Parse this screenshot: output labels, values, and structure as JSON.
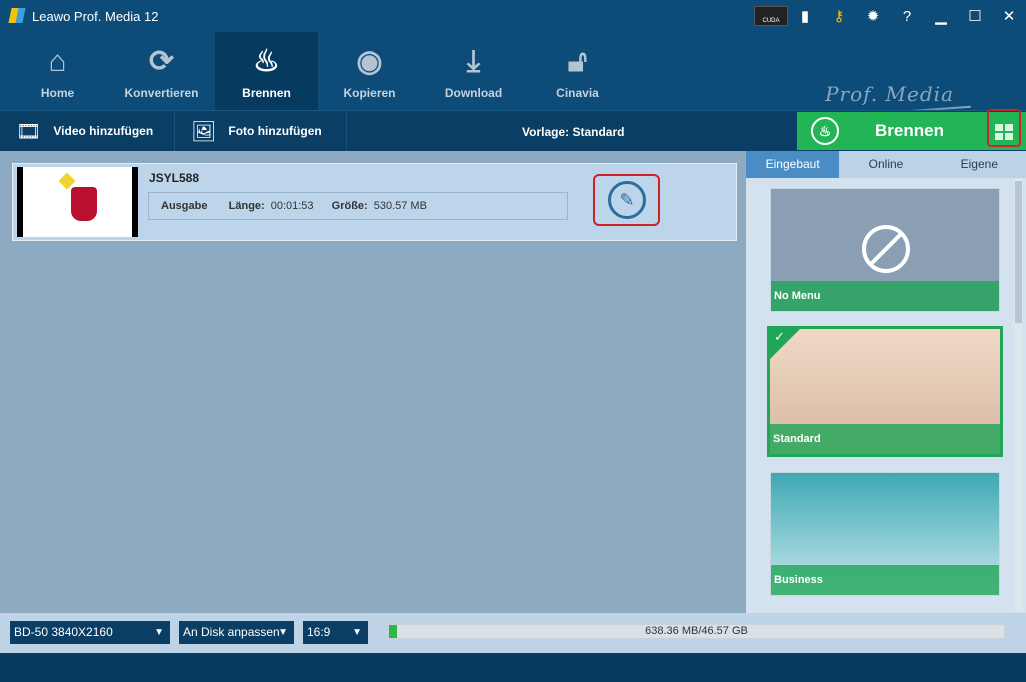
{
  "app": {
    "title": "Leawo Prof. Media 12",
    "brand": "Prof. Media"
  },
  "titlebar_icons": [
    "cuda-icon",
    "chat-icon",
    "key-icon",
    "gear-icon",
    "help-icon",
    "minimize-icon",
    "maximize-icon",
    "close-icon"
  ],
  "cuda_label": "CUDA",
  "nav": [
    {
      "label": "Home",
      "icon": "home-icon"
    },
    {
      "label": "Konvertieren",
      "icon": "convert-icon"
    },
    {
      "label": "Brennen",
      "icon": "flame-icon",
      "active": true
    },
    {
      "label": "Kopieren",
      "icon": "disc-icon"
    },
    {
      "label": "Download",
      "icon": "download-icon"
    },
    {
      "label": "Cinavia",
      "icon": "unlock-icon"
    }
  ],
  "toolbar": {
    "add_video": "Video hinzufügen",
    "add_photo": "Foto hinzufügen",
    "template": "Vorlage: Standard",
    "burn": "Brennen"
  },
  "video": {
    "name": "JSYL588",
    "output_label": "Ausgabe",
    "length_label": "Länge:",
    "length": "00:01:53",
    "size_label": "Größe:",
    "size": "530.57 MB"
  },
  "side": {
    "tabs": [
      "Eingebaut",
      "Online",
      "Eigene"
    ],
    "active_tab": "Eingebaut",
    "templates": [
      {
        "label": "No Menu"
      },
      {
        "label": "Standard",
        "selected": true
      },
      {
        "label": "Business"
      }
    ]
  },
  "bottom": {
    "disc": "BD-50 3840X2160",
    "fit": "An Disk anpassen",
    "aspect": "16:9",
    "usage": "638.36 MB/46.57 GB",
    "usage_fraction": 0.0134
  },
  "colors": {
    "accent_green": "#22b556",
    "nav_bg": "#0d4b78"
  }
}
